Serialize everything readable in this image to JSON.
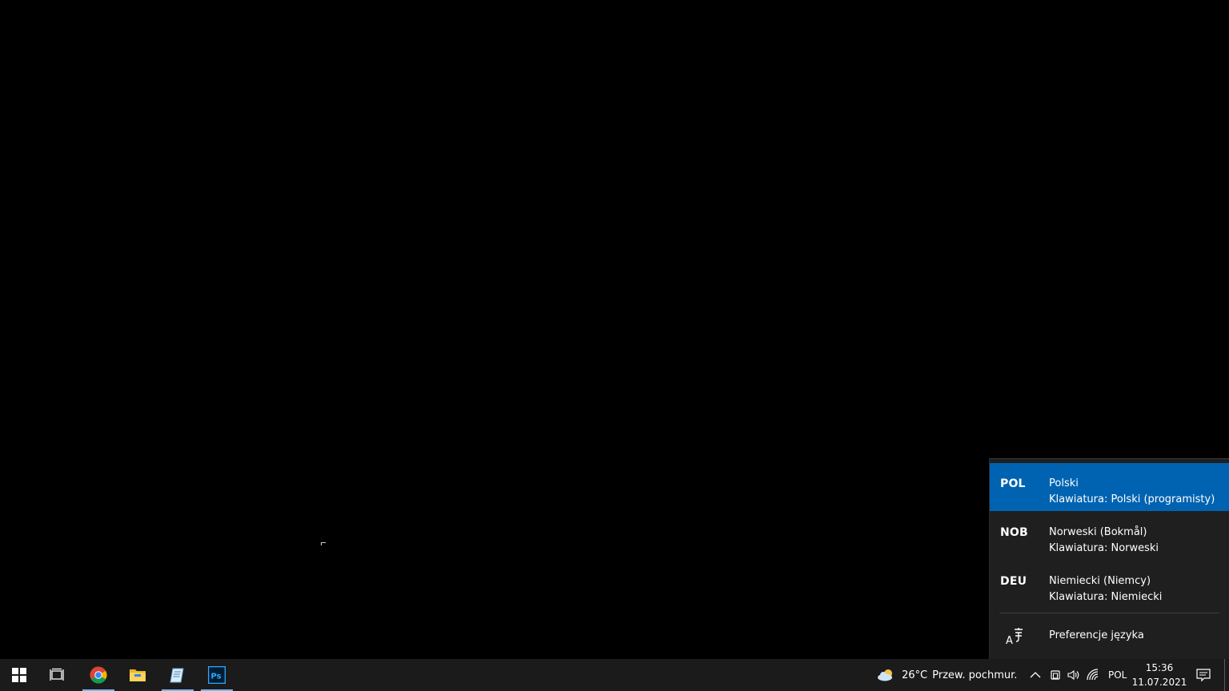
{
  "language_flyout": {
    "items": [
      {
        "code": "POL",
        "name": "Polski",
        "keyboard": "Klawiatura: Polski (programisty)",
        "selected": true
      },
      {
        "code": "NOB",
        "name": "Norweski (Bokmål)",
        "keyboard": "Klawiatura: Norweski",
        "selected": false
      },
      {
        "code": "DEU",
        "name": "Niemiecki (Niemcy)",
        "keyboard": "Klawiatura: Niemiecki",
        "selected": false
      }
    ],
    "preferences_label": "Preferencje języka",
    "selected_color": "#0063b1"
  },
  "taskbar": {
    "apps": [
      {
        "icon": "windows-start-icon"
      },
      {
        "icon": "task-view-icon"
      },
      {
        "icon": "chrome-icon",
        "active": true
      },
      {
        "icon": "file-explorer-icon"
      },
      {
        "icon": "notepad-icon",
        "active": true
      },
      {
        "icon": "photoshop-icon",
        "active": true,
        "label": "Ps"
      }
    ],
    "weather": {
      "temperature": "26°C",
      "condition": "Przew. pochmur."
    },
    "input_indicator": "POL",
    "time": "15:36",
    "date": "11.07.2021",
    "active_indicator_color": "#76b9ed"
  }
}
